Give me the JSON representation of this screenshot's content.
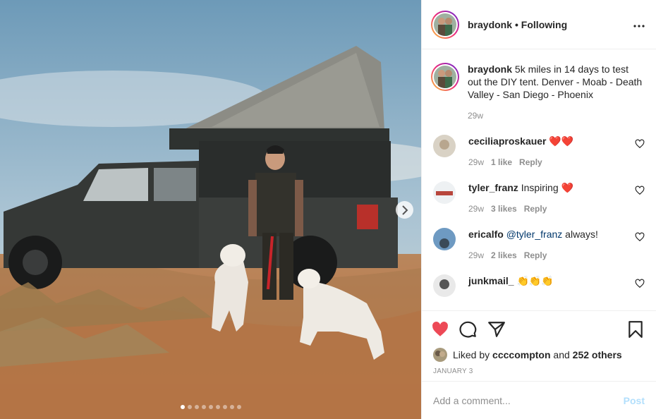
{
  "post": {
    "username": "braydonk",
    "follow_state": "• Following",
    "more_icon": "more-dots-icon",
    "caption_user": "braydonk",
    "caption_text": "5k miles in 14 days to test out the DIY tent. Denver - Moab - Death Valley - San Diego - Phoenix",
    "caption_time": "29w",
    "photo_index": 1,
    "photo_count": 9
  },
  "comments": [
    {
      "user": "ceciliaproskauer",
      "text": "",
      "emoji": "❤️❤️",
      "time": "29w",
      "likes": "1 like",
      "reply": "Reply"
    },
    {
      "user": "tyler_franz",
      "text": "Inspiring",
      "emoji": "❤️",
      "time": "29w",
      "likes": "3 likes",
      "reply": "Reply"
    },
    {
      "user": "ericalfo",
      "mention": "@tyler_franz",
      "text": "always!",
      "time": "29w",
      "likes": "2 likes",
      "reply": "Reply"
    },
    {
      "user": "junkmail_",
      "text": "",
      "emoji": "👏👏👏"
    }
  ],
  "engagement": {
    "liked_by_prefix": "Liked by",
    "liked_by_user": "ccccompton",
    "liked_by_suffix": "and",
    "others": "252 others",
    "date": "JANUARY 3"
  },
  "composer": {
    "placeholder": "Add a comment...",
    "post_label": "Post"
  },
  "colors": {
    "like_red": "#ed4956",
    "post_disabled": "#b2dffc",
    "muted": "#8e8e8e"
  }
}
